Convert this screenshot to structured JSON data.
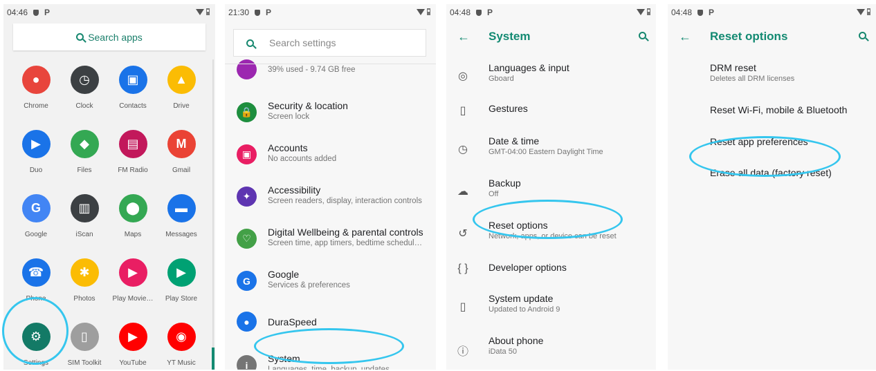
{
  "screen1": {
    "status_time": "04:46",
    "status_p": "P",
    "search_label": "Search apps",
    "apps": [
      {
        "name": "Chrome",
        "icon": "chrome-icon",
        "color": "#e8453c",
        "glyph": "●"
      },
      {
        "name": "Clock",
        "icon": "clock-icon",
        "color": "#3c4043",
        "glyph": "◷"
      },
      {
        "name": "Contacts",
        "icon": "contacts-icon",
        "color": "#1a73e8",
        "glyph": "▣"
      },
      {
        "name": "Drive",
        "icon": "drive-icon",
        "color": "#fbbc04",
        "glyph": "▲"
      },
      {
        "name": "Duo",
        "icon": "duo-icon",
        "color": "#1a73e8",
        "glyph": "▶"
      },
      {
        "name": "Files",
        "icon": "files-icon",
        "color": "#34a853",
        "glyph": "◆"
      },
      {
        "name": "FM Radio",
        "icon": "fm-radio-icon",
        "color": "#c2185b",
        "glyph": "▤"
      },
      {
        "name": "Gmail",
        "icon": "gmail-icon",
        "color": "#ea4335",
        "glyph": "M"
      },
      {
        "name": "Google",
        "icon": "google-icon",
        "color": "#4285f4",
        "glyph": "G"
      },
      {
        "name": "iScan",
        "icon": "iscan-icon",
        "color": "#3c4043",
        "glyph": "▥"
      },
      {
        "name": "Maps",
        "icon": "maps-icon",
        "color": "#34a853",
        "glyph": "⬤"
      },
      {
        "name": "Messages",
        "icon": "messages-icon",
        "color": "#1a73e8",
        "glyph": "▬"
      },
      {
        "name": "Phone",
        "icon": "phone-icon",
        "color": "#1a73e8",
        "glyph": "☎"
      },
      {
        "name": "Photos",
        "icon": "photos-icon",
        "color": "#fbbc04",
        "glyph": "✱"
      },
      {
        "name": "Play Movie…",
        "icon": "play-movies-icon",
        "color": "#e91e63",
        "glyph": "▶"
      },
      {
        "name": "Play Store",
        "icon": "play-store-icon",
        "color": "#00a173",
        "glyph": "▶"
      },
      {
        "name": "Settings",
        "icon": "settings-icon",
        "color": "#137a66",
        "glyph": "⚙"
      },
      {
        "name": "SIM Toolkit",
        "icon": "sim-toolkit-icon",
        "color": "#9e9e9e",
        "glyph": "▯"
      },
      {
        "name": "YouTube",
        "icon": "youtube-icon",
        "color": "#ff0000",
        "glyph": "▶"
      },
      {
        "name": "YT Music",
        "icon": "yt-music-icon",
        "color": "#ff0000",
        "glyph": "◉"
      }
    ]
  },
  "screen2": {
    "status_time": "21:30",
    "status_p": "P",
    "search_placeholder": "Search settings",
    "items": [
      {
        "title": "",
        "sub": "39% used - 9.74 GB free",
        "icon": "storage-icon",
        "color": "#9c27b0",
        "glyph": ""
      },
      {
        "title": "Security & location",
        "sub": "Screen lock",
        "icon": "lock-icon",
        "color": "#1e8e3e",
        "glyph": "🔒"
      },
      {
        "title": "Accounts",
        "sub": "No accounts added",
        "icon": "accounts-icon",
        "color": "#e91e63",
        "glyph": "▣"
      },
      {
        "title": "Accessibility",
        "sub": "Screen readers, display, interaction controls",
        "icon": "accessibility-icon",
        "color": "#5e35b1",
        "glyph": "✦"
      },
      {
        "title": "Digital Wellbeing & parental controls",
        "sub": "Screen time, app timers, bedtime schedul…",
        "icon": "wellbeing-icon",
        "color": "#43a047",
        "glyph": "♡"
      },
      {
        "title": "Google",
        "sub": "Services & preferences",
        "icon": "google-icon",
        "color": "#1a73e8",
        "glyph": "G"
      },
      {
        "title": "DuraSpeed",
        "sub": "",
        "icon": "duraspeed-icon",
        "color": "#1a73e8",
        "glyph": "●"
      },
      {
        "title": "System",
        "sub": "Languages, time, backup, updates",
        "icon": "info-icon",
        "color": "#757575",
        "glyph": "i"
      }
    ]
  },
  "screen3": {
    "status_time": "04:48",
    "status_p": "P",
    "title": "System",
    "items": [
      {
        "title": "Languages & input",
        "sub": "Gboard",
        "icon": "globe-icon",
        "glyph": "◎"
      },
      {
        "title": "Gestures",
        "sub": "",
        "icon": "gestures-icon",
        "glyph": "▯"
      },
      {
        "title": "Date & time",
        "sub": "GMT-04:00 Eastern Daylight Time",
        "icon": "clock-icon",
        "glyph": "◷"
      },
      {
        "title": "Backup",
        "sub": "Off",
        "icon": "cloud-upload-icon",
        "glyph": "☁"
      },
      {
        "title": "Reset options",
        "sub": "Network, apps, or device can be reset",
        "icon": "history-icon",
        "glyph": "↺"
      },
      {
        "title": "Developer options",
        "sub": "",
        "icon": "code-braces-icon",
        "glyph": "{ }"
      },
      {
        "title": "System update",
        "sub": "Updated to Android 9",
        "icon": "system-update-icon",
        "glyph": "▯"
      },
      {
        "title": "About phone",
        "sub": "iData 50",
        "icon": "info-icon",
        "glyph": "ⓘ"
      }
    ]
  },
  "screen4": {
    "status_time": "04:48",
    "status_p": "P",
    "title": "Reset options",
    "items": [
      {
        "title": "DRM reset",
        "sub": "Deletes all DRM licenses"
      },
      {
        "title": "Reset Wi-Fi, mobile & Bluetooth",
        "sub": ""
      },
      {
        "title": "Reset app preferences",
        "sub": ""
      },
      {
        "title": "Erase all data (factory reset)",
        "sub": ""
      }
    ]
  },
  "annotation_color": "#35c6ee"
}
